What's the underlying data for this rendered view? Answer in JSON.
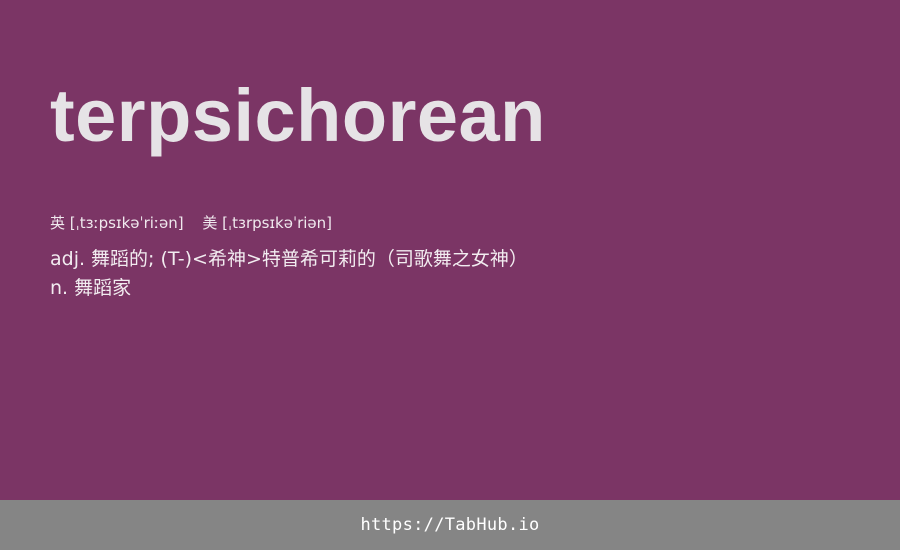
{
  "colors": {
    "background": "#7b3565",
    "word_text": "#e6e3e6",
    "body_text": "#f2ecf0",
    "footer_bg": "#858585",
    "footer_text": "#ffffff"
  },
  "entry": {
    "word": "terpsichorean",
    "phonetics": {
      "uk": "英 [ˌtɜːpsɪkəˈriːən]",
      "us": "美 [ˌtɜrpsɪkəˈriən]"
    },
    "definitions": [
      "adj. 舞蹈的; (T-)<希神>特普希可莉的（司歌舞之女神）",
      "n. 舞蹈家"
    ]
  },
  "footer": {
    "url": "https://TabHub.io"
  }
}
